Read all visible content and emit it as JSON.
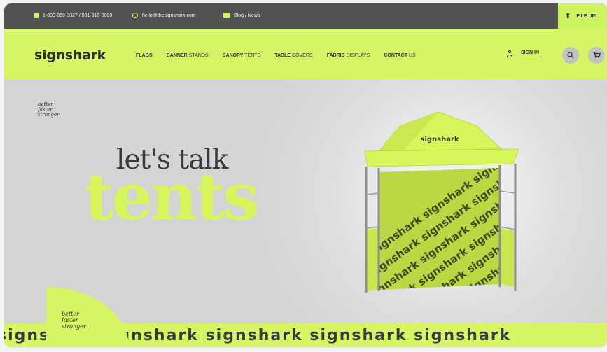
{
  "topbar": {
    "phone": "1-800-859-3327 / 831-318-0089",
    "email": "hello@thesignshark.com",
    "blog": "Blog / News",
    "upload": "FILE UPL"
  },
  "nav": {
    "logo": "signshark",
    "menu": [
      {
        "bold": "FLAGS",
        "rest": ""
      },
      {
        "bold": "BANNER",
        "rest": "STANDS"
      },
      {
        "bold": "CANOPY",
        "rest": "TENTS"
      },
      {
        "bold": "TABLE",
        "rest": "COVERS"
      },
      {
        "bold": "FABRIC",
        "rest": "DISPLAYS"
      },
      {
        "bold": "CONTACT",
        "rest": "US"
      }
    ],
    "signin": "SIGN IN"
  },
  "hero": {
    "tagline": [
      "better",
      "faster",
      "stronger"
    ],
    "line1": "let's talk",
    "line2": "tents",
    "tent_brand": "signshark",
    "pattern_text": "signshark signshark signshark"
  },
  "bottom": {
    "tagline": [
      "better",
      "faster",
      "stronger"
    ],
    "strip_text": "signshark signshark signshark signshark signshark"
  },
  "colors": {
    "accent": "#d5f565",
    "topbar": "#525252"
  }
}
